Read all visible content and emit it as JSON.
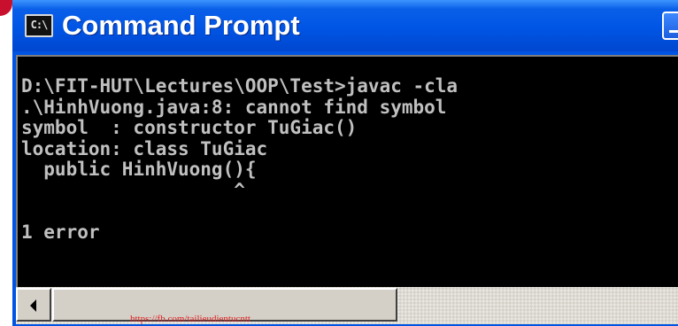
{
  "window": {
    "title": "Command Prompt",
    "icon_label": "C:\\",
    "icon": "console-icon"
  },
  "console": {
    "lines": [
      "D:\\FIT-HUT\\Lectures\\OOP\\Test>javac -cla",
      ".\\HinhVuong.java:8: cannot find symbol",
      "symbol  : constructor TuGiac()",
      "location: class TuGiac",
      "  public HinhVuong(){",
      "                   ^",
      "",
      "1 error"
    ]
  },
  "scrollbar": {
    "left_arrow_icon": "arrow-left-icon"
  },
  "footer": {
    "link_text": "https://fb.com/tailieudientucntt"
  },
  "colors": {
    "titlebar": "#0055e5",
    "console_bg": "#000000",
    "console_text": "#c0c0c0",
    "accent_red": "#c8102e"
  }
}
